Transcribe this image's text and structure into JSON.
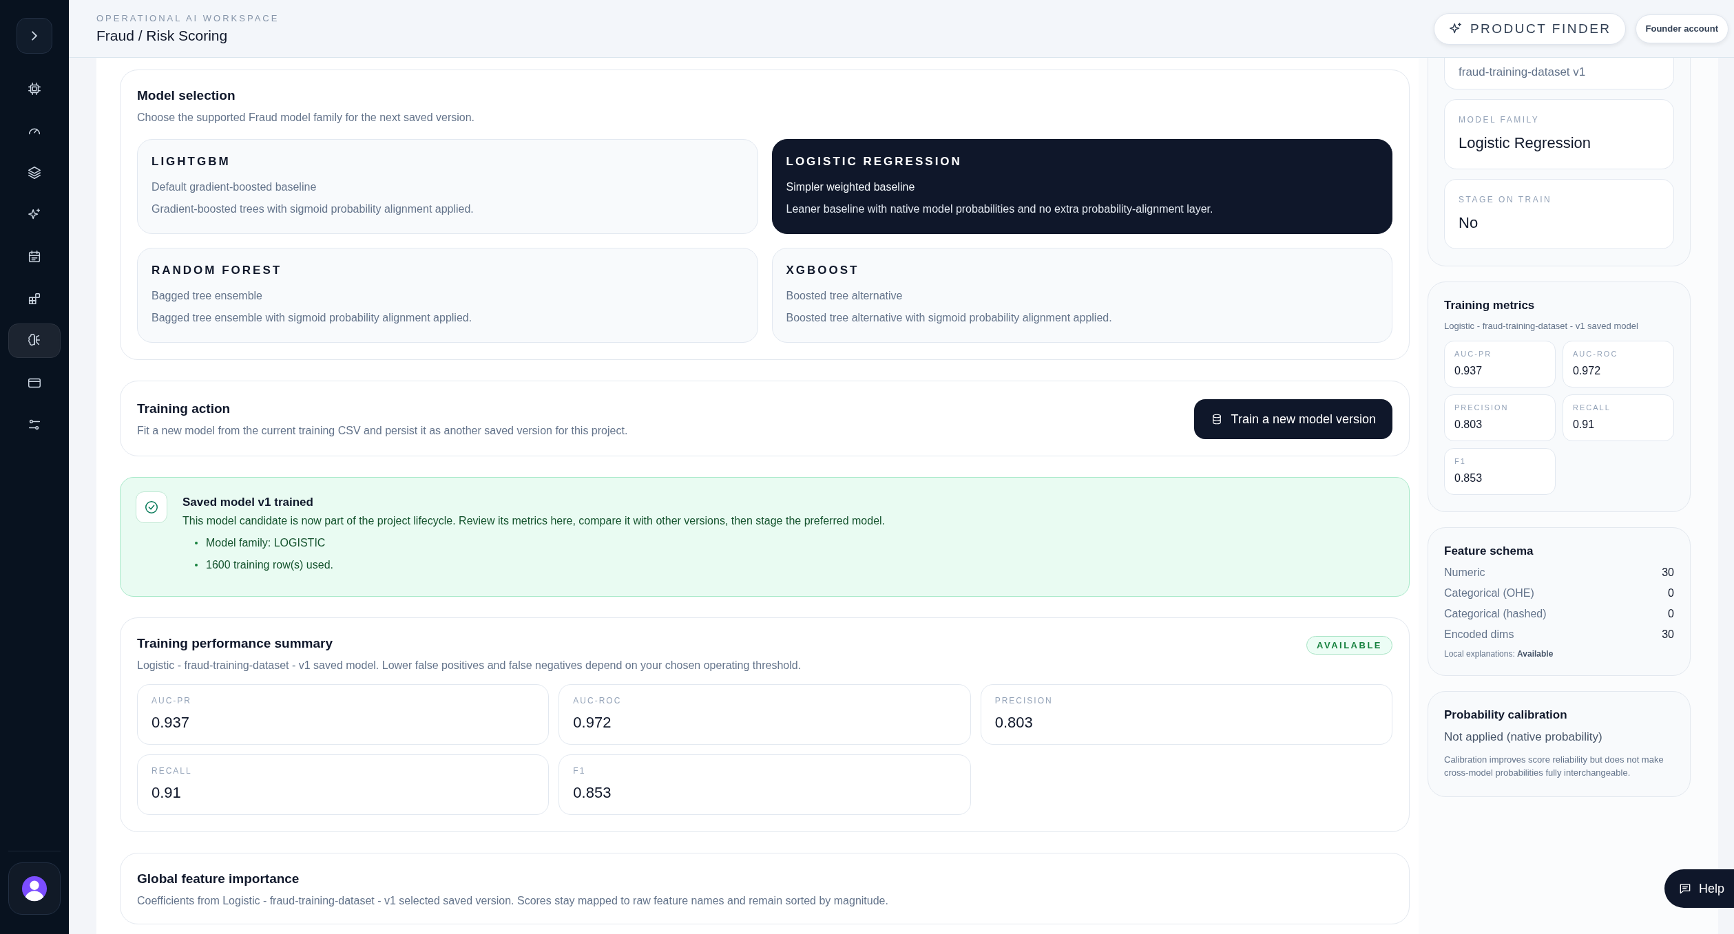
{
  "sidebar": {
    "items": [
      {
        "selected": false
      },
      {
        "selected": false
      },
      {
        "selected": false
      },
      {
        "selected": false
      },
      {
        "selected": false
      },
      {
        "selected": false
      },
      {
        "selected": true
      },
      {
        "selected": false
      },
      {
        "selected": false
      }
    ]
  },
  "header": {
    "eyebrow": "OPERATIONAL AI WORKSPACE",
    "title": "Fraud / Risk Scoring",
    "product_finder": "PRODUCT FINDER",
    "account": "Founder account"
  },
  "model_selection": {
    "title": "Model selection",
    "subtitle": "Choose the supported Fraud model family for the next saved version.",
    "options": [
      {
        "name": "LIGHTGBM",
        "tagline": "Default gradient-boosted baseline",
        "description": "Gradient-boosted trees with sigmoid probability alignment applied.",
        "selected": false
      },
      {
        "name": "LOGISTIC REGRESSION",
        "tagline": "Simpler weighted baseline",
        "description": "Leaner baseline with native model probabilities and no extra probability-alignment layer.",
        "selected": true
      },
      {
        "name": "RANDOM FOREST",
        "tagline": "Bagged tree ensemble",
        "description": "Bagged tree ensemble with sigmoid probability alignment applied.",
        "selected": false
      },
      {
        "name": "XGBOOST",
        "tagline": "Boosted tree alternative",
        "description": "Boosted tree alternative with sigmoid probability alignment applied.",
        "selected": false
      }
    ]
  },
  "training_action": {
    "title": "Training action",
    "subtitle": "Fit a new model from the current training CSV and persist it as another saved version for this project.",
    "button": "Train a new model version"
  },
  "notice": {
    "title": "Saved model v1 trained",
    "message": "This model candidate is now part of the project lifecycle. Review its metrics here, compare it with other versions, then stage the preferred model.",
    "bullets": [
      "Model family: LOGISTIC",
      "1600 training row(s) used."
    ]
  },
  "performance_summary": {
    "title": "Training performance summary",
    "badge": "AVAILABLE",
    "subtitle": "Logistic - fraud-training-dataset - v1 saved model. Lower false positives and false negatives depend on your chosen operating threshold.",
    "metrics": [
      {
        "label": "AUC-PR",
        "value": "0.937"
      },
      {
        "label": "AUC-ROC",
        "value": "0.972"
      },
      {
        "label": "PRECISION",
        "value": "0.803"
      },
      {
        "label": "RECALL",
        "value": "0.91"
      },
      {
        "label": "F1",
        "value": "0.853"
      }
    ]
  },
  "feature_importance": {
    "title": "Global feature importance",
    "subtitle": "Coefficients from Logistic - fraud-training-dataset - v1 selected saved version. Scores stay mapped to raw feature names and remain sorted by magnitude."
  },
  "run_config": {
    "fields": [
      {
        "value": "fraud-training-dataset v1"
      },
      {
        "label": "MODEL FAMILY",
        "value": "Logistic Regression"
      },
      {
        "label": "STAGE ON TRAIN",
        "value": "No"
      }
    ]
  },
  "training_metrics": {
    "title": "Training metrics",
    "subtitle": "Logistic - fraud-training-dataset - v1 saved model",
    "metrics": [
      {
        "label": "AUC-PR",
        "value": "0.937"
      },
      {
        "label": "AUC-ROC",
        "value": "0.972"
      },
      {
        "label": "PRECISION",
        "value": "0.803"
      },
      {
        "label": "RECALL",
        "value": "0.91"
      },
      {
        "label": "F1",
        "value": "0.853"
      }
    ]
  },
  "feature_schema": {
    "title": "Feature schema",
    "rows": [
      {
        "label": "Numeric",
        "value": "30"
      },
      {
        "label": "Categorical (OHE)",
        "value": "0"
      },
      {
        "label": "Categorical (hashed)",
        "value": "0"
      },
      {
        "label": "Encoded dims",
        "value": "30"
      }
    ],
    "note": "Local explanations: **Available**"
  },
  "calibration": {
    "title": "Probability calibration",
    "status": "Not applied (native probability)",
    "note": "Calibration improves score reliability but does not make cross-model probabilities fully interchangeable."
  },
  "help_button": "Help"
}
